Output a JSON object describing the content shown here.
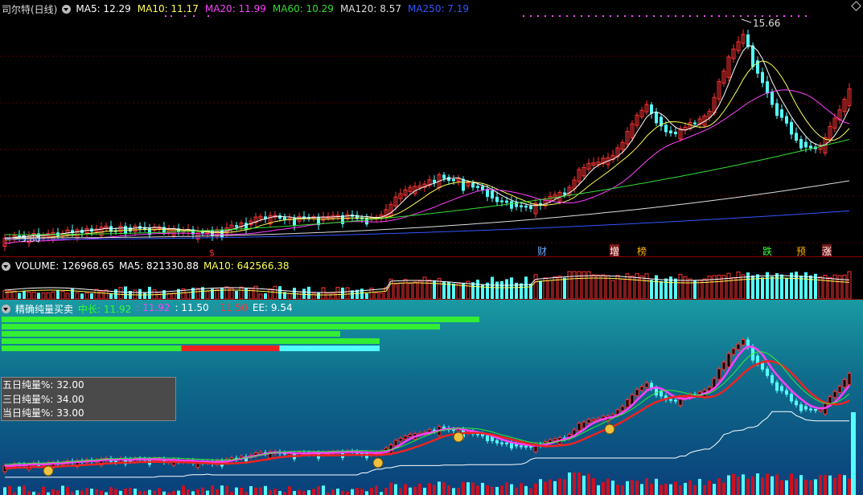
{
  "price_pane": {
    "stock": "司尔特(日线)",
    "ma": [
      {
        "label": "MA5: 12.29",
        "color": "#ffffff"
      },
      {
        "label": "MA10: 11.17",
        "color": "#ffff55"
      },
      {
        "label": "MA20: 11.99",
        "color": "#ff40ff"
      },
      {
        "label": "MA60: 10.29",
        "color": "#33dd33"
      },
      {
        "label": "MA120: 8.57",
        "color": "#dddddd"
      },
      {
        "label": "MA250: 7.19",
        "color": "#3355ff"
      }
    ],
    "high_label": "15.66",
    "low_label": "5.80",
    "dollar_mark": "$",
    "tags": [
      {
        "text": "财",
        "color": "#6aa8ff",
        "bg": "#000"
      },
      {
        "text": "增",
        "color": "#ffffff",
        "bg": "#7a1a1a"
      },
      {
        "text": "榜",
        "color": "#ffb000",
        "bg": "#000"
      },
      {
        "text": "跌",
        "color": "#33ff33",
        "bg": "#000"
      },
      {
        "text": "预",
        "color": "#ffb000",
        "bg": "#000"
      },
      {
        "text": "涨",
        "color": "#ffffff",
        "bg": "#7a1a1a"
      }
    ]
  },
  "volume_pane": {
    "volume_label": "VOLUME: 126968.65",
    "ma5_label": "MA5: 821330.88",
    "ma10_label": "MA10: 642566.38"
  },
  "indicator_pane": {
    "title": "精确纯量买卖",
    "parts": [
      {
        "text": "中长: 11.92",
        "color": "#33ff33"
      },
      {
        "text": ": 11.92",
        "color": "#ff40ff"
      },
      {
        "text": ": 11.50",
        "color": "#ffffff"
      },
      {
        "text": ": 11.50",
        "color": "#ff3333"
      },
      {
        "text": "EE: 9.54",
        "color": "#ffffff"
      }
    ],
    "stats": {
      "five_day": "五日纯量%: 32.00",
      "three_day": "三日纯量%: 34.00",
      "today": "当日纯量%: 33.00"
    }
  },
  "colors": {
    "up": "#ff3333",
    "down": "#54ffff",
    "accent": "#8a0000"
  }
}
